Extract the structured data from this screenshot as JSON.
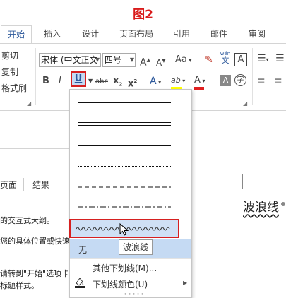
{
  "figure_caption": "图2",
  "tabs": [
    "开始",
    "插入",
    "设计",
    "页面布局",
    "引用",
    "邮件",
    "审阅"
  ],
  "clipboard": {
    "cut": "剪切",
    "copy": "复制",
    "format_painter": "格式刷"
  },
  "font": {
    "name": "宋体 (中文正文",
    "size": "四号",
    "grow": "A",
    "shrink": "A",
    "case": "Aa",
    "bold": "B",
    "italic": "I",
    "underline": "U",
    "strike": "abc",
    "subscript": "x",
    "superscript": "x",
    "effects": "A",
    "highlight": "ab",
    "font_color": "A",
    "shading": "A",
    "enclose": "字",
    "phonetic": "wén"
  },
  "underline_menu": {
    "styles": [
      "single",
      "double",
      "thick",
      "dotted",
      "dashed",
      "dash-dot",
      "dash-dot-dot",
      "wavy"
    ],
    "selected": "wavy",
    "none_label": "无",
    "tooltip": "波浪线",
    "more": "其他下划线(M)...",
    "color": "下划线颜色(U)"
  },
  "nav_pane": {
    "tab_pages": "页面",
    "tab_results": "结果",
    "line1": "的交互式大纲。",
    "line2": "您的具体位置或快速",
    "line3": "请转到\"开始\"选项卡",
    "line4": "标题样式。"
  },
  "document": {
    "sample_text": "波浪线"
  },
  "colors": {
    "accent": "#2b579a",
    "highlight_red": "#d62020",
    "selection_blue": "#c5daf3",
    "caption_red": "#d91b1b"
  }
}
